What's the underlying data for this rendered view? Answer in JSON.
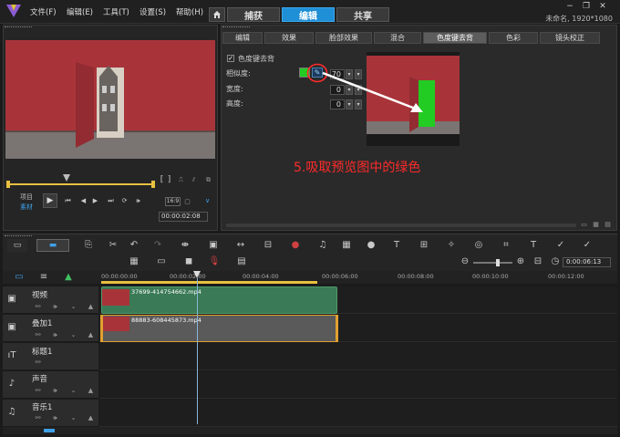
{
  "menu": {
    "file": "文件(F)",
    "edit": "编辑(E)",
    "tools": "工具(T)",
    "settings": "设置(S)",
    "help": "帮助(H)"
  },
  "main_tabs": [
    "捕获",
    "编辑",
    "共享"
  ],
  "active_main_tab": "编辑",
  "project": {
    "name": "未命名, 1920*1080"
  },
  "preview": {
    "mode_project": "项目",
    "mode_clip": "素材",
    "timecode": "00:00:02:08",
    "quality": "16:9"
  },
  "options_tabs": [
    "编辑",
    "效果",
    "脸部效果",
    "混合",
    "色度键去背",
    "色彩",
    "镜头校正"
  ],
  "active_options_tab": "色度键去背",
  "chroma_key": {
    "enable_label": "色度键去背",
    "enabled": true,
    "similarity_label": "相似度:",
    "similarity_value": "70",
    "width_label": "宽度:",
    "width_value": "0",
    "height_label": "高度:",
    "height_value": "0",
    "key_color": "#22cc22"
  },
  "annotation": "5.吸取预览图中的绿色",
  "timeline": {
    "timecode": "0:00:06:13",
    "ruler_ticks": [
      "00:00:00:00",
      "00:00:02:00",
      "00:00:04:00",
      "00:00:06:00",
      "00:00:08:00",
      "00:00:10:00",
      "00:00:12:00"
    ],
    "tracks": [
      {
        "name": "视频",
        "clip": "37699-414754662.mp4"
      },
      {
        "name": "叠加1",
        "clip": "88883-608445873.mp4"
      },
      {
        "name": "标题1",
        "clip": ""
      },
      {
        "name": "声音",
        "clip": ""
      },
      {
        "name": "音乐1",
        "clip": ""
      }
    ]
  },
  "colors": {
    "accent": "#1f8fd6",
    "video_clip": "#3a7a56",
    "overlay_clip_border": "#e0a030",
    "annotation_red": "#ff2a2a"
  }
}
